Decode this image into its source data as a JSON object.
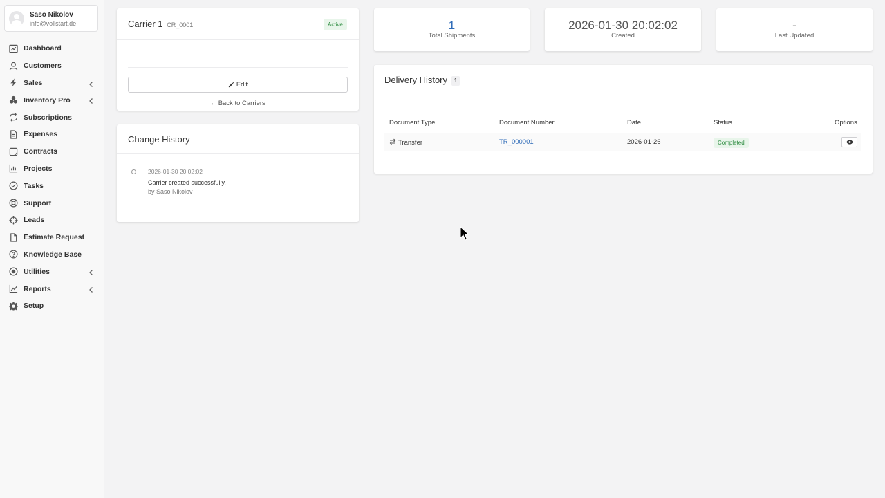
{
  "user": {
    "name": "Saso Nikolov",
    "email": "info@vollstart.de"
  },
  "sidebar": {
    "items": [
      {
        "label": "Dashboard",
        "icon": "dashboard-icon",
        "has_children": false
      },
      {
        "label": "Customers",
        "icon": "user-icon",
        "has_children": false
      },
      {
        "label": "Sales",
        "icon": "bolt-icon",
        "has_children": true
      },
      {
        "label": "Inventory Pro",
        "icon": "cubes-icon",
        "has_children": true
      },
      {
        "label": "Subscriptions",
        "icon": "repeat-icon",
        "has_children": false
      },
      {
        "label": "Expenses",
        "icon": "file-icon",
        "has_children": false
      },
      {
        "label": "Contracts",
        "icon": "contract-icon",
        "has_children": false
      },
      {
        "label": "Projects",
        "icon": "chart-icon",
        "has_children": false
      },
      {
        "label": "Tasks",
        "icon": "check-circle-icon",
        "has_children": false
      },
      {
        "label": "Support",
        "icon": "lifebuoy-icon",
        "has_children": false
      },
      {
        "label": "Leads",
        "icon": "crosshair-icon",
        "has_children": false
      },
      {
        "label": "Estimate Request",
        "icon": "document-icon",
        "has_children": false
      },
      {
        "label": "Knowledge Base",
        "icon": "question-circle-icon",
        "has_children": false
      },
      {
        "label": "Utilities",
        "icon": "dot-circle-icon",
        "has_children": true
      },
      {
        "label": "Reports",
        "icon": "line-chart-icon",
        "has_children": true
      },
      {
        "label": "Setup",
        "icon": "gear-icon",
        "has_children": false
      }
    ]
  },
  "carrier": {
    "name": "Carrier 1",
    "code": "CR_0001",
    "status": "Active",
    "edit_label": "Edit",
    "back_label": "Back to Carriers"
  },
  "change_history": {
    "title": "Change History",
    "entries": [
      {
        "date": "2026-01-30 20:02:02",
        "message": "Carrier created successfully.",
        "by": "by Saso Nikolov"
      }
    ]
  },
  "stats": [
    {
      "value": "1",
      "label": "Total Shipments"
    },
    {
      "value": "2026-01-30 20:02:02",
      "label": "Created"
    },
    {
      "value": "-",
      "label": "Last Updated"
    }
  ],
  "delivery_history": {
    "title": "Delivery History",
    "count": "1",
    "columns": [
      "Document Type",
      "Document Number",
      "Date",
      "Status",
      "Options"
    ],
    "rows": [
      {
        "type": "Transfer",
        "number": "TR_000001",
        "date": "2026-01-26",
        "status": "Completed"
      }
    ]
  },
  "colors": {
    "accent": "#2e6bb8",
    "success_bg": "#e8f5ea",
    "success_text": "#2b8a3e"
  }
}
